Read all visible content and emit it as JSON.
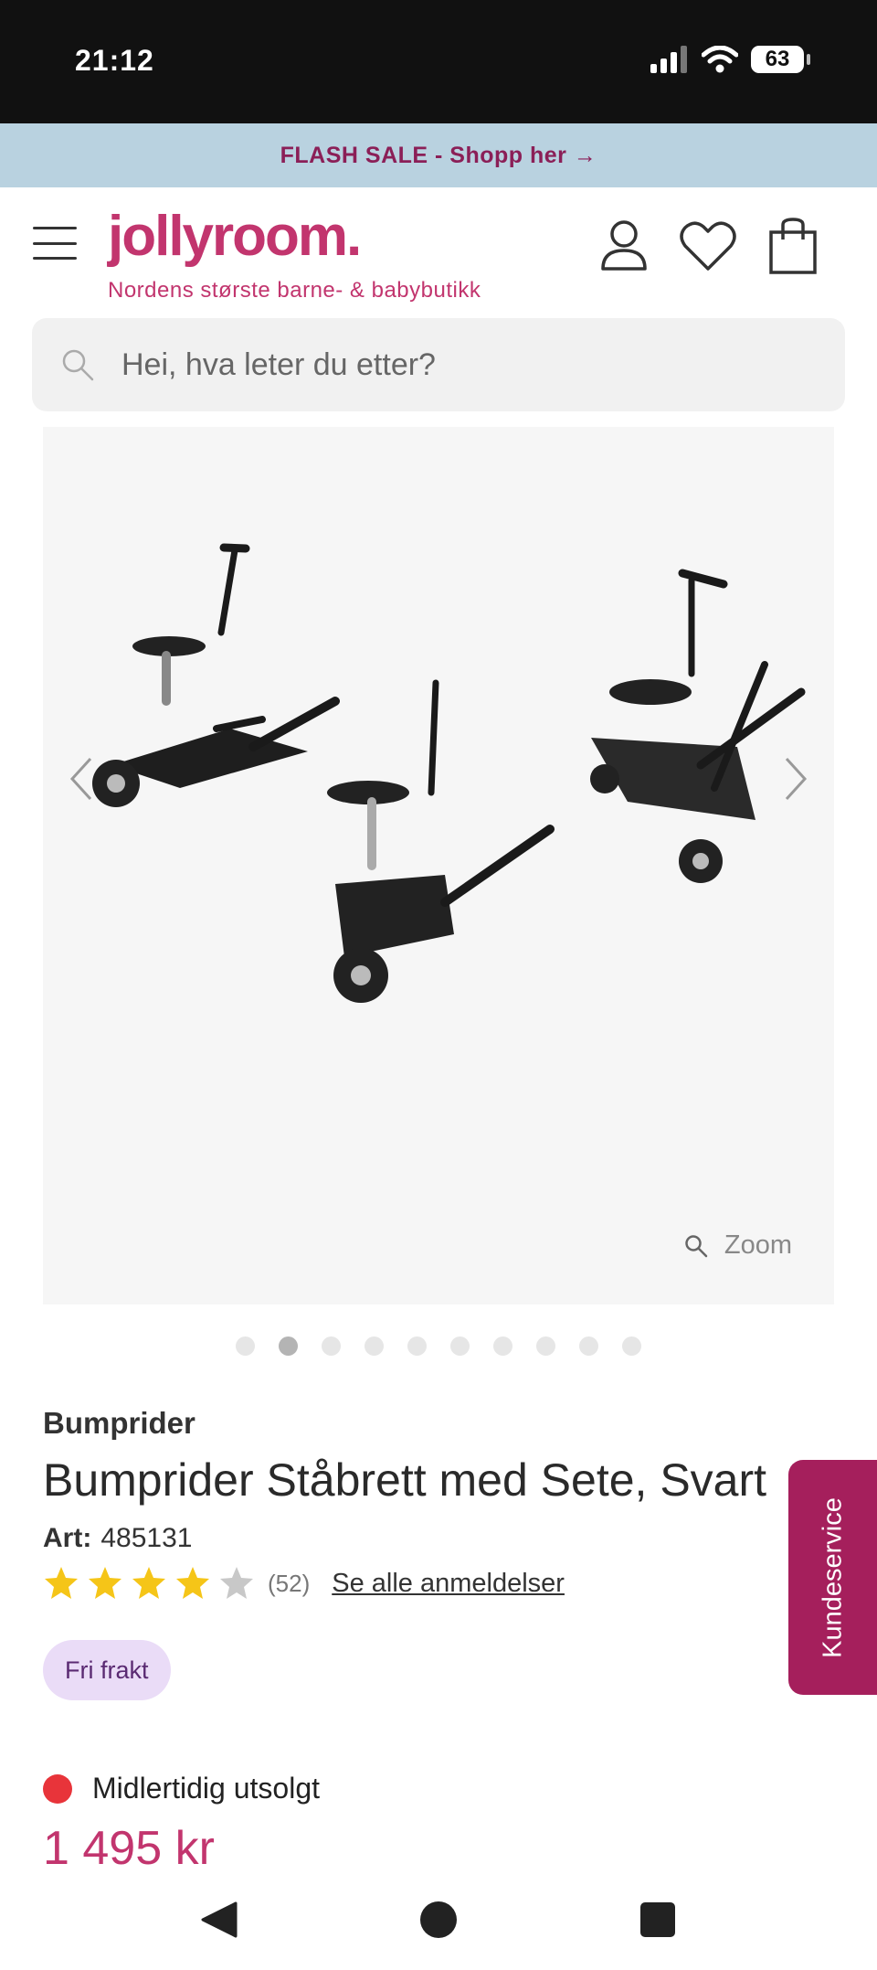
{
  "status_bar": {
    "time": "21:12",
    "battery": "63"
  },
  "banner": {
    "text": "FLASH SALE - Shopp her →"
  },
  "header": {
    "logo": "jollyroom.",
    "tagline": "Nordens største barne- & babybutikk"
  },
  "search": {
    "placeholder": "Hei, hva leter du etter?"
  },
  "gallery": {
    "zoom_label": "Zoom",
    "image_count": 10,
    "active_index": 1
  },
  "product": {
    "brand": "Bumprider",
    "title": "Bumprider Ståbrett med Sete, Svart",
    "art_label": "Art:",
    "art_number": "485131",
    "rating": 4,
    "rating_max": 5,
    "review_count": "(52)",
    "reviews_link": "Se alle anmeldelser",
    "badge": "Fri frakt",
    "stock_status": "Midlertidig utsolgt",
    "price": "1 495 kr"
  },
  "side_tab": {
    "label": "Kundeservice"
  },
  "colors": {
    "brand": "#c2356e",
    "side_tab": "#a51f5c",
    "banner_bg": "#b9d2e0",
    "out_of_stock": "#e8343a"
  }
}
